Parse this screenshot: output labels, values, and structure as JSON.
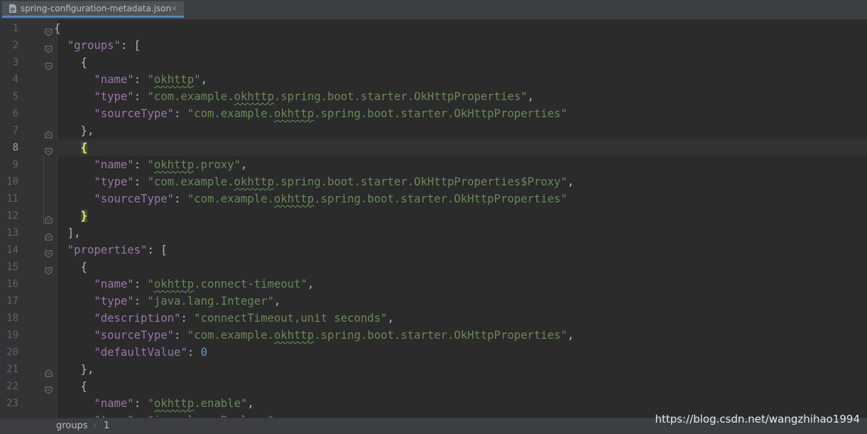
{
  "tab": {
    "filename": "spring-configuration-metadata.json",
    "icon": "json-file-icon",
    "close": "×"
  },
  "lines": [
    {
      "n": "1",
      "fold": "open",
      "tokens": [
        [
          "p",
          "{"
        ]
      ]
    },
    {
      "n": "2",
      "fold": "open",
      "tokens": [
        [
          "p",
          "  "
        ],
        [
          "k",
          "\"groups\""
        ],
        [
          "p",
          ": ["
        ]
      ]
    },
    {
      "n": "3",
      "fold": "open",
      "tokens": [
        [
          "p",
          "    {"
        ]
      ]
    },
    {
      "n": "4",
      "fold": "",
      "tokens": [
        [
          "p",
          "      "
        ],
        [
          "k",
          "\"name\""
        ],
        [
          "p",
          ": "
        ],
        [
          "s",
          "\""
        ],
        [
          "sw",
          "okhttp"
        ],
        [
          "s",
          "\""
        ],
        [
          "p",
          ","
        ]
      ]
    },
    {
      "n": "5",
      "fold": "",
      "tokens": [
        [
          "p",
          "      "
        ],
        [
          "k",
          "\"type\""
        ],
        [
          "p",
          ": "
        ],
        [
          "s",
          "\"com.example."
        ],
        [
          "sw",
          "okhttp"
        ],
        [
          "s",
          ".spring.boot.starter.OkHttpProperties\""
        ],
        [
          "p",
          ","
        ]
      ]
    },
    {
      "n": "6",
      "fold": "",
      "tokens": [
        [
          "p",
          "      "
        ],
        [
          "k",
          "\"sourceType\""
        ],
        [
          "p",
          ": "
        ],
        [
          "s",
          "\"com.example."
        ],
        [
          "sw",
          "okhttp"
        ],
        [
          "s",
          ".spring.boot.starter.OkHttpProperties\""
        ]
      ]
    },
    {
      "n": "7",
      "fold": "close",
      "tokens": [
        [
          "p",
          "    },"
        ]
      ]
    },
    {
      "n": "8",
      "fold": "open",
      "current": true,
      "tokens": [
        [
          "p",
          "    "
        ],
        [
          "hl",
          "{"
        ]
      ]
    },
    {
      "n": "9",
      "fold": "",
      "tokens": [
        [
          "p",
          "      "
        ],
        [
          "k",
          "\"name\""
        ],
        [
          "p",
          ": "
        ],
        [
          "s",
          "\""
        ],
        [
          "sw",
          "okhttp"
        ],
        [
          "s",
          ".proxy\""
        ],
        [
          "p",
          ","
        ]
      ]
    },
    {
      "n": "10",
      "fold": "",
      "tokens": [
        [
          "p",
          "      "
        ],
        [
          "k",
          "\"type\""
        ],
        [
          "p",
          ": "
        ],
        [
          "s",
          "\"com.example."
        ],
        [
          "sw",
          "okhttp"
        ],
        [
          "s",
          ".spring.boot.starter.OkHttpProperties$Proxy\""
        ],
        [
          "p",
          ","
        ]
      ]
    },
    {
      "n": "11",
      "fold": "",
      "tokens": [
        [
          "p",
          "      "
        ],
        [
          "k",
          "\"sourceType\""
        ],
        [
          "p",
          ": "
        ],
        [
          "s",
          "\"com.example."
        ],
        [
          "sw",
          "okhttp"
        ],
        [
          "s",
          ".spring.boot.starter.OkHttpProperties\""
        ]
      ]
    },
    {
      "n": "12",
      "fold": "close",
      "tokens": [
        [
          "p",
          "    "
        ],
        [
          "hl",
          "}"
        ]
      ]
    },
    {
      "n": "13",
      "fold": "close",
      "tokens": [
        [
          "p",
          "  ],"
        ]
      ]
    },
    {
      "n": "14",
      "fold": "open",
      "tokens": [
        [
          "p",
          "  "
        ],
        [
          "k",
          "\"properties\""
        ],
        [
          "p",
          ": ["
        ]
      ]
    },
    {
      "n": "15",
      "fold": "open",
      "tokens": [
        [
          "p",
          "    {"
        ]
      ]
    },
    {
      "n": "16",
      "fold": "",
      "tokens": [
        [
          "p",
          "      "
        ],
        [
          "k",
          "\"name\""
        ],
        [
          "p",
          ": "
        ],
        [
          "s",
          "\""
        ],
        [
          "sw",
          "okhttp"
        ],
        [
          "s",
          ".connect-timeout\""
        ],
        [
          "p",
          ","
        ]
      ]
    },
    {
      "n": "17",
      "fold": "",
      "tokens": [
        [
          "p",
          "      "
        ],
        [
          "k",
          "\"type\""
        ],
        [
          "p",
          ": "
        ],
        [
          "s",
          "\"java.lang.Integer\""
        ],
        [
          "p",
          ","
        ]
      ]
    },
    {
      "n": "18",
      "fold": "",
      "tokens": [
        [
          "p",
          "      "
        ],
        [
          "k",
          "\"description\""
        ],
        [
          "p",
          ": "
        ],
        [
          "s",
          "\"connectTimeout,unit seconds\""
        ],
        [
          "p",
          ","
        ]
      ]
    },
    {
      "n": "19",
      "fold": "",
      "tokens": [
        [
          "p",
          "      "
        ],
        [
          "k",
          "\"sourceType\""
        ],
        [
          "p",
          ": "
        ],
        [
          "s",
          "\"com.example."
        ],
        [
          "sw",
          "okhttp"
        ],
        [
          "s",
          ".spring.boot.starter.OkHttpProperties\""
        ],
        [
          "p",
          ","
        ]
      ]
    },
    {
      "n": "20",
      "fold": "",
      "tokens": [
        [
          "p",
          "      "
        ],
        [
          "k",
          "\"defaultValue\""
        ],
        [
          "p",
          ": "
        ],
        [
          "n",
          "0"
        ]
      ]
    },
    {
      "n": "21",
      "fold": "close",
      "tokens": [
        [
          "p",
          "    },"
        ]
      ]
    },
    {
      "n": "22",
      "fold": "open",
      "tokens": [
        [
          "p",
          "    {"
        ]
      ]
    },
    {
      "n": "23",
      "fold": "",
      "tokens": [
        [
          "p",
          "      "
        ],
        [
          "k",
          "\"name\""
        ],
        [
          "p",
          ": "
        ],
        [
          "s",
          "\""
        ],
        [
          "sw",
          "okhttp"
        ],
        [
          "s",
          ".enable\""
        ],
        [
          "p",
          ","
        ]
      ]
    },
    {
      "n": "",
      "fold": "",
      "tokens": [
        [
          "p",
          "      "
        ],
        [
          "k",
          "\"type\""
        ],
        [
          "p",
          ": "
        ],
        [
          "s",
          "\"java.lang.Boolean\""
        ],
        [
          "p",
          ","
        ]
      ]
    }
  ],
  "breadcrumb": {
    "items": [
      "groups",
      "1"
    ],
    "separator": "›"
  },
  "watermark": "https://blog.csdn.net/wangzhihao1994",
  "colors": {
    "background": "#2b2b2b",
    "key": "#9876aa",
    "string": "#6a8759",
    "number": "#6897bb",
    "punct": "#a9b7c6"
  }
}
